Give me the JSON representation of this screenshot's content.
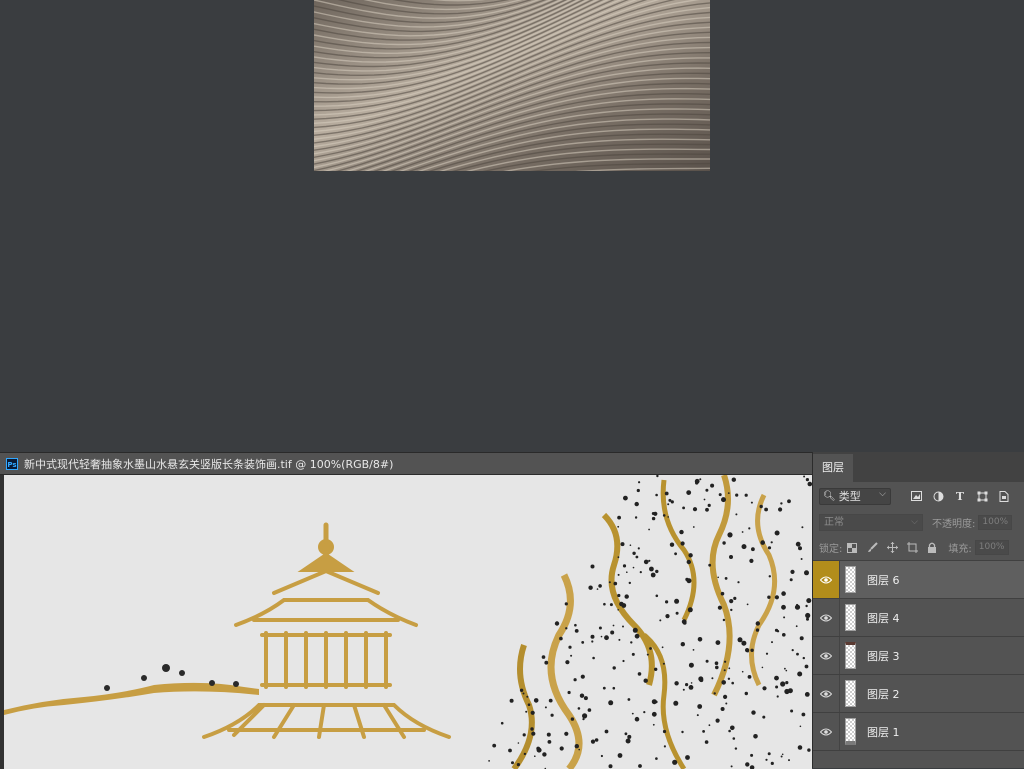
{
  "document": {
    "tab_title": "新中式现代轻奢抽象水墨山水悬玄关竖版长条装饰画.tif @ 100%(RGB/8#)",
    "app_icon_text": "Ps"
  },
  "layers_panel": {
    "tab_label": "图层",
    "filter": {
      "selected": "类型"
    },
    "filter_icons": [
      "image-filter-icon",
      "adjustment-filter-icon",
      "type-filter-icon",
      "shape-filter-icon",
      "smart-object-filter-icon"
    ],
    "blend_mode": "正常",
    "opacity_label": "不透明度:",
    "opacity_value": "100%",
    "lock_label": "锁定:",
    "lock_icons": [
      "lock-transparent-icon",
      "lock-paint-icon",
      "lock-move-icon",
      "lock-artboard-icon",
      "lock-all-icon"
    ],
    "fill_label": "填充:",
    "fill_value": "100%",
    "layers": [
      {
        "name": "图层 6",
        "visible": true,
        "selected": true
      },
      {
        "name": "图层 4",
        "visible": true,
        "selected": false
      },
      {
        "name": "图层 3",
        "visible": true,
        "selected": false
      },
      {
        "name": "图层 2",
        "visible": true,
        "selected": false
      },
      {
        "name": "图层 1",
        "visible": true,
        "selected": false
      }
    ]
  },
  "colors": {
    "workspace": "#3a3d40",
    "panel": "#535353",
    "selected_eye": "#b28d1b",
    "canvas_background": "#e6e6e6",
    "gold": "#c9a24a"
  }
}
